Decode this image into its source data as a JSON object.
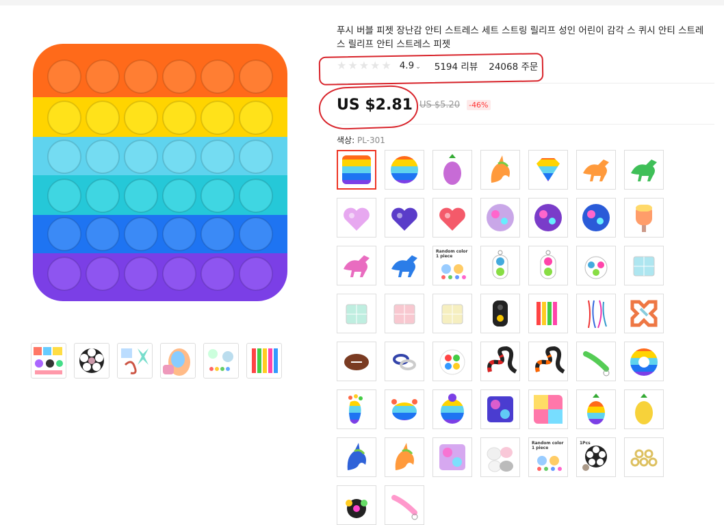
{
  "product": {
    "title": "푸시 버블 피젯 장난감 안티 스트레스 세트 스트링 릴리프 성인 어린이 감각 스 퀴시 안티 스트레스 릴리프 안티 스트레스 피젯",
    "rating": "4.9",
    "reviews": "5194 리뷰",
    "orders": "24068 주문",
    "price": "US $2.81",
    "old_price": "US $5.20",
    "discount": "-46%"
  },
  "variants": {
    "label": "색상:",
    "selected_value": "PL-301",
    "items": [
      {
        "name": "rainbow-square",
        "kind": "square-rainbow"
      },
      {
        "name": "rainbow-circle",
        "kind": "circle-rainbow"
      },
      {
        "name": "pineapple-tie-dye",
        "kind": "pineapple"
      },
      {
        "name": "unicorn-rainbow",
        "kind": "unicorn"
      },
      {
        "name": "diamond-rainbow",
        "kind": "diamond"
      },
      {
        "name": "dinosaur-rainbow",
        "kind": "dino"
      },
      {
        "name": "dinosaur-green",
        "kind": "dino-green"
      },
      {
        "name": "heart-pastel",
        "kind": "heart-pastel"
      },
      {
        "name": "heart-galaxy",
        "kind": "heart-galaxy"
      },
      {
        "name": "heart-tie-dye",
        "kind": "heart-tie"
      },
      {
        "name": "circle-pastel",
        "kind": "circle-pastel"
      },
      {
        "name": "circle-galaxy",
        "kind": "circle-galaxy"
      },
      {
        "name": "circle-blue-galaxy",
        "kind": "circle-blue"
      },
      {
        "name": "popsicle",
        "kind": "popsicle"
      },
      {
        "name": "dinosaur-tie-dye",
        "kind": "dino-tie"
      },
      {
        "name": "dinosaur-blue",
        "kind": "dino-blue"
      },
      {
        "name": "random-color-1",
        "kind": "random",
        "label": "Random color 1 piece"
      },
      {
        "name": "simple-dimple-2",
        "kind": "dimple-2"
      },
      {
        "name": "simple-dimple-2b",
        "kind": "dimple-2b"
      },
      {
        "name": "simple-dimple-3",
        "kind": "dimple-3"
      },
      {
        "name": "infinity-cube-blue",
        "kind": "cube-blue"
      },
      {
        "name": "infinity-cube-mint",
        "kind": "cube-mint"
      },
      {
        "name": "infinity-cube-pink",
        "kind": "cube-pink"
      },
      {
        "name": "infinity-cube-yellow",
        "kind": "cube-yellow"
      },
      {
        "name": "fidget-pad",
        "kind": "pad"
      },
      {
        "name": "marble-mesh",
        "kind": "mesh"
      },
      {
        "name": "stretch-strings",
        "kind": "strings"
      },
      {
        "name": "cross-link",
        "kind": "cross"
      },
      {
        "name": "squishy-football",
        "kind": "football"
      },
      {
        "name": "bike-chain",
        "kind": "chain"
      },
      {
        "name": "rainbow-ball",
        "kind": "ball"
      },
      {
        "name": "tangle-red",
        "kind": "tangle-red"
      },
      {
        "name": "tangle-orange",
        "kind": "tangle-orange"
      },
      {
        "name": "keychain-green",
        "kind": "keychain"
      },
      {
        "name": "rainbow-ring",
        "kind": "ring"
      },
      {
        "name": "foot-rainbow",
        "kind": "foot"
      },
      {
        "name": "crab-rainbow",
        "kind": "crab"
      },
      {
        "name": "ladybug-rainbow",
        "kind": "bug"
      },
      {
        "name": "square-galaxy",
        "kind": "square-galaxy"
      },
      {
        "name": "square-pastel",
        "kind": "square-pastel"
      },
      {
        "name": "pineapple-rainbow",
        "kind": "pineapple-rainbow"
      },
      {
        "name": "pineapple-yellow",
        "kind": "pineapple-yellow"
      },
      {
        "name": "unicorn-galaxy",
        "kind": "unicorn-blue"
      },
      {
        "name": "unicorn-rainbow-2",
        "kind": "unicorn-2"
      },
      {
        "name": "square-tie-dye",
        "kind": "square-tie"
      },
      {
        "name": "squishy-cats",
        "kind": "cats"
      },
      {
        "name": "random-color-2",
        "kind": "random-2",
        "label": "Random color 1 piece"
      },
      {
        "name": "flower-spinner",
        "kind": "flower",
        "label": "1Pcs"
      },
      {
        "name": "rings-set",
        "kind": "rings"
      },
      {
        "name": "spinner-dark",
        "kind": "spinner"
      },
      {
        "name": "keychain-pastel",
        "kind": "keychain-pastel"
      }
    ]
  },
  "colors": {
    "annotation": "#d8232a",
    "selected_border": "#ee3322",
    "discount": "#ff3333"
  }
}
